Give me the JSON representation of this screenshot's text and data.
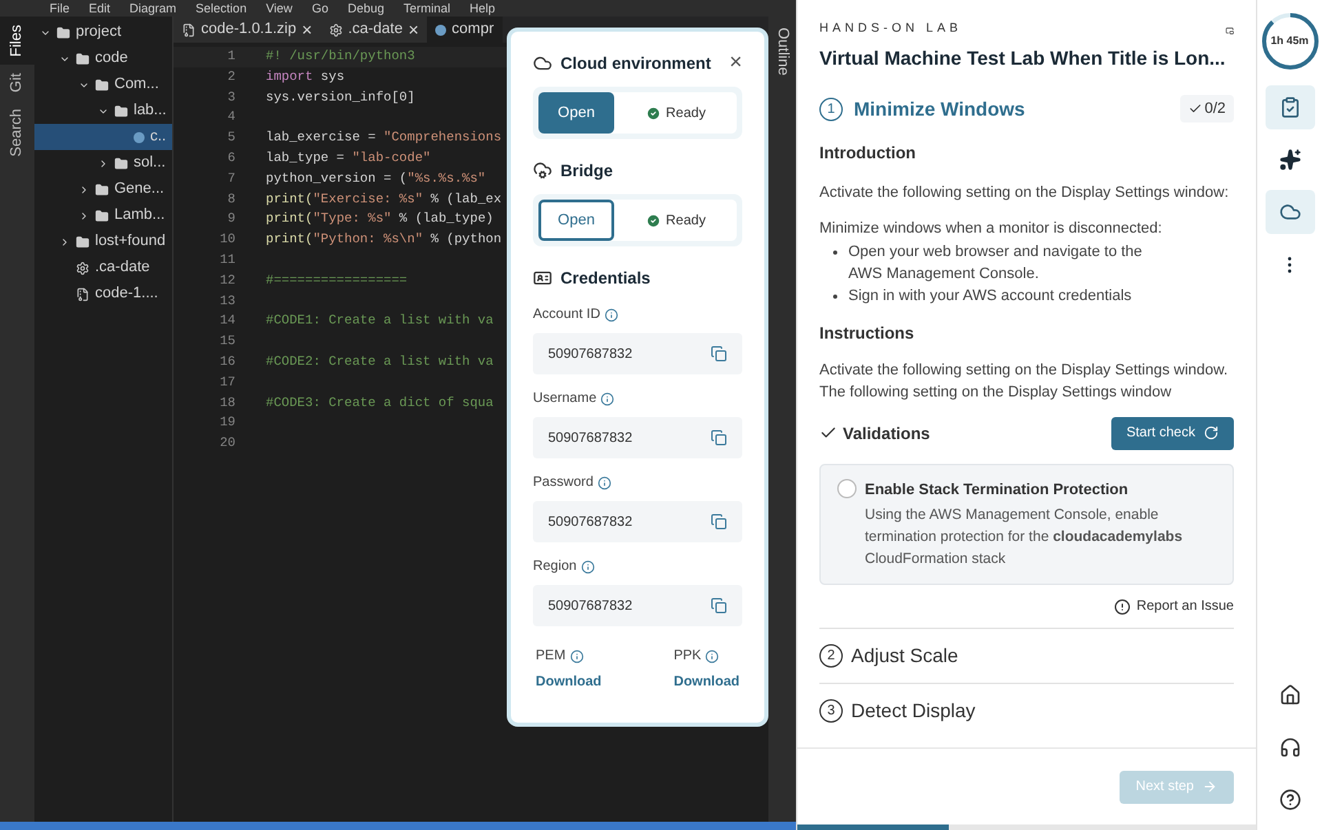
{
  "menu": [
    "File",
    "Edit",
    "Diagram",
    "Selection",
    "View",
    "Go",
    "Debug",
    "Terminal",
    "Help"
  ],
  "activity_bar": [
    {
      "label": "Files",
      "selected": true
    },
    {
      "label": "Git",
      "selected": false
    },
    {
      "label": "Search",
      "selected": false
    }
  ],
  "file_tree": [
    {
      "label": "project",
      "kind": "folder",
      "expanded": true,
      "selected": false,
      "children": [
        {
          "label": "code",
          "kind": "folder",
          "expanded": true,
          "selected": false,
          "children": [
            {
              "label": "Com...",
              "kind": "folder",
              "expanded": true,
              "selected": false,
              "children": [
                {
                  "label": "lab...",
                  "kind": "folder",
                  "expanded": true,
                  "selected": false,
                  "children": [
                    {
                      "label": "c..",
                      "kind": "python",
                      "selected": true
                    }
                  ]
                },
                {
                  "label": "sol...",
                  "kind": "folder",
                  "expanded": false,
                  "selected": false
                }
              ]
            },
            {
              "label": "Gene...",
              "kind": "folder",
              "expanded": false,
              "selected": false
            },
            {
              "label": "Lamb...",
              "kind": "folder",
              "expanded": false,
              "selected": false
            }
          ]
        },
        {
          "label": "lost+found",
          "kind": "folder",
          "expanded": false,
          "selected": false
        },
        {
          "label": ".ca-date",
          "kind": "config",
          "selected": false
        },
        {
          "label": "code-1....",
          "kind": "archive",
          "selected": false
        }
      ]
    }
  ],
  "editor_tabs": [
    {
      "label": "code-1.0.1.zip",
      "kind": "archive",
      "selected": false,
      "close": "×"
    },
    {
      "label": ".ca-date",
      "kind": "config",
      "selected": false,
      "close": "×"
    },
    {
      "label": "compr",
      "kind": "python",
      "selected": true
    }
  ],
  "code_lines": [
    {
      "number": "1",
      "tokens": [
        {
          "kind": "comment",
          "text": "#! /usr/bin/python3"
        }
      ]
    },
    {
      "number": "2",
      "tokens": [
        {
          "kind": "keyword",
          "text": "import"
        },
        {
          "kind": "plain",
          "text": " sys"
        }
      ]
    },
    {
      "number": "3",
      "tokens": [
        {
          "kind": "plain",
          "text": "sys.version_info[0]"
        }
      ]
    },
    {
      "number": "4"
    },
    {
      "number": "5",
      "tokens": [
        {
          "kind": "plain",
          "text": "lab_exercise = "
        },
        {
          "kind": "string",
          "text": "\"Comprehensions"
        }
      ]
    },
    {
      "number": "6",
      "tokens": [
        {
          "kind": "plain",
          "text": "lab_type = "
        },
        {
          "kind": "string",
          "text": "\"lab-code\""
        }
      ]
    },
    {
      "number": "7",
      "tokens": [
        {
          "kind": "plain",
          "text": "python_version = ("
        },
        {
          "kind": "string",
          "text": "\"%s.%s.%s\""
        }
      ]
    },
    {
      "number": "8",
      "tokens": [
        {
          "kind": "func",
          "text": "print("
        },
        {
          "kind": "string",
          "text": "\"Exercise: %s\""
        },
        {
          "kind": "plain",
          "text": " % (lab_ex"
        }
      ]
    },
    {
      "number": "9",
      "tokens": [
        {
          "kind": "func",
          "text": "print("
        },
        {
          "kind": "string",
          "text": "\"Type: %s\""
        },
        {
          "kind": "plain",
          "text": " % (lab_type)"
        }
      ]
    },
    {
      "number": "10",
      "tokens": [
        {
          "kind": "func",
          "text": "print("
        },
        {
          "kind": "string",
          "text": "\"Python: %s\\n\""
        },
        {
          "kind": "plain",
          "text": " % (python"
        }
      ]
    },
    {
      "number": "11"
    },
    {
      "number": "12",
      "tokens": [
        {
          "kind": "comment",
          "text": "#================="
        }
      ]
    },
    {
      "number": "13"
    },
    {
      "number": "14",
      "tokens": [
        {
          "kind": "comment",
          "text": "#CODE1: Create a list with va"
        }
      ]
    },
    {
      "number": "15"
    },
    {
      "number": "16",
      "tokens": [
        {
          "kind": "comment",
          "text": "#CODE2: Create a list with va"
        }
      ]
    },
    {
      "number": "17"
    },
    {
      "number": "18",
      "tokens": [
        {
          "kind": "comment",
          "text": "#CODE3: Create a dict of squa"
        }
      ]
    },
    {
      "number": "19"
    },
    {
      "number": "20"
    }
  ],
  "outline_tab": "Outline",
  "cloud_popup": {
    "title": "Cloud environment",
    "close": "×",
    "environment": {
      "open_label": "Open",
      "filled": true,
      "status": "Ready"
    },
    "bridge": {
      "title": "Bridge",
      "open_label": "Open",
      "filled": false,
      "status": "Ready"
    },
    "credentials_title": "Credentials",
    "fields": [
      {
        "label": "Account ID",
        "value": "50907687832"
      },
      {
        "label": "Username",
        "value": "50907687832"
      },
      {
        "label": "Password",
        "value": "50907687832"
      },
      {
        "label": "Region",
        "value": "50907687832"
      }
    ],
    "downloads": [
      {
        "label": "PEM",
        "link": "Download"
      },
      {
        "label": "PPK",
        "link": "Download"
      }
    ]
  },
  "lab": {
    "eyebrow": "HANDS-ON LAB",
    "title": "Virtual Machine Test Lab When Title is Lon...",
    "current_step": {
      "number": "1",
      "title": "Minimize Windows",
      "progress": "0/2",
      "intro_heading": "Introduction",
      "intro_text": "Activate the following setting on the Display Settings window:",
      "list_intro": "Minimize windows when a monitor is disconnected:",
      "bullets": [
        "Open your web browser and navigate to the AWS Management Console.",
        "Sign in with your AWS account credentials"
      ],
      "instructions_heading": "Instructions",
      "instructions_text": "Activate the following setting on the Display Settings window. The following setting on the Display Settings window",
      "validations_heading": "Validations",
      "start_check": "Start check",
      "checks": [
        {
          "title": "Enable Stack Termination Protection",
          "text": "Using the AWS Management Console, enable termination protection for the **cloudacademylabs** CloudFormation stack",
          "checked": false
        }
      ],
      "report": "Report an Issue"
    },
    "other_steps": [
      {
        "number": "2",
        "title": "Adjust Scale"
      },
      {
        "number": "3",
        "title": "Detect Display"
      }
    ],
    "next_button": {
      "label": "Next step",
      "disabled": true
    },
    "progress": {
      "level": 0.33
    }
  },
  "rail": {
    "timer": {
      "label": "1h 45m",
      "level": 0.88
    },
    "top_buttons": [
      {
        "kind": "clipboard",
        "selected": true
      },
      {
        "kind": "sparkle",
        "selected": false
      },
      {
        "kind": "cloud",
        "selected": true
      },
      {
        "kind": "more",
        "selected": false
      }
    ],
    "bottom_buttons": [
      {
        "kind": "home"
      },
      {
        "kind": "headset"
      },
      {
        "kind": "help"
      }
    ]
  }
}
